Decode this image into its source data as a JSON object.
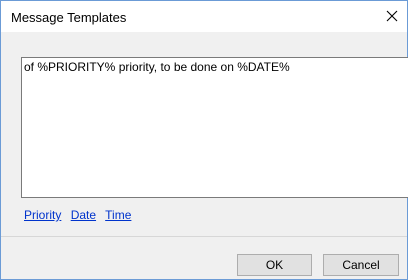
{
  "window": {
    "title": "Message Templates"
  },
  "editor": {
    "text": "of %PRIORITY% priority, to be done on %DATE%"
  },
  "links": [
    {
      "label": "Priority"
    },
    {
      "label": "Date"
    },
    {
      "label": "Time"
    }
  ],
  "buttons": {
    "ok": "OK",
    "cancel": "Cancel"
  },
  "icons": {
    "close": "close-icon"
  },
  "colors": {
    "link": "#0033cc",
    "window_border": "#6b9bd6",
    "dialog_bg": "#f0f0f0",
    "button_bg": "#e1e1e1"
  }
}
